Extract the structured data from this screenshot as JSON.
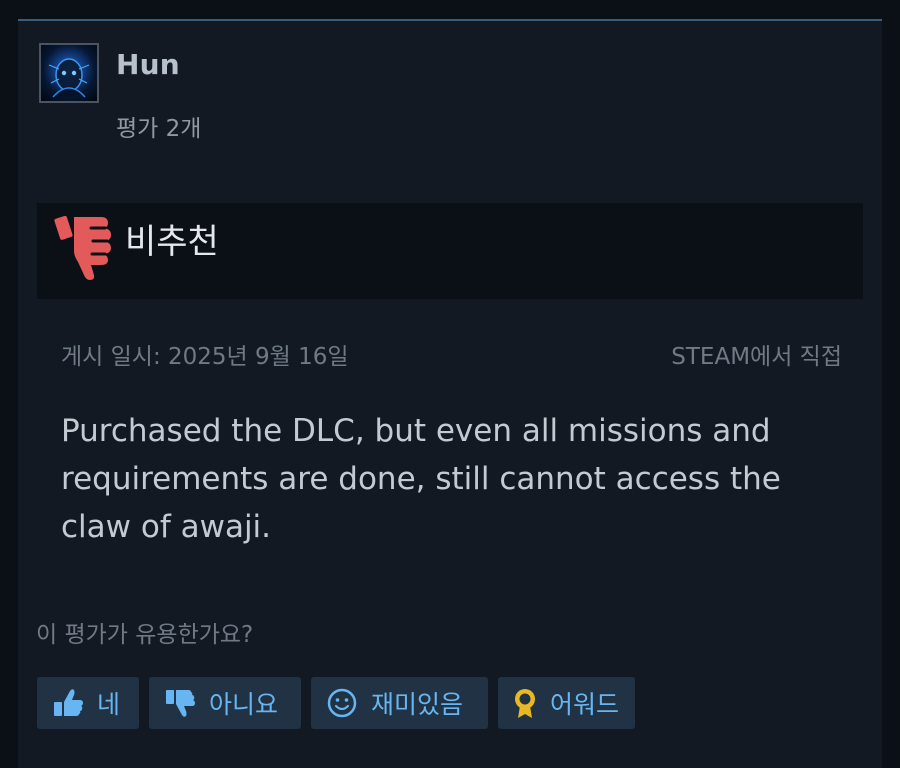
{
  "review": {
    "author": {
      "name": "Hun",
      "review_count": "평가 2개"
    },
    "verdict": {
      "label": "비추천",
      "icon": "thumbs-down-icon"
    },
    "posted": "게시 일시: 2025년 9월 16일",
    "source": "STEAM에서 직접",
    "body": "Purchased the DLC, but even all missions and requirements are done, still cannot access the claw of awaji."
  },
  "helpful": {
    "question": "이 평가가 유용한가요?",
    "buttons": [
      {
        "label": "네",
        "icon": "thumbs-up-icon"
      },
      {
        "label": "아니요",
        "icon": "thumbs-down-icon"
      },
      {
        "label": "재미있음",
        "icon": "smiley-icon"
      },
      {
        "label": "어워드",
        "icon": "award-icon"
      }
    ]
  },
  "colors": {
    "card_background": "#121923",
    "verdict_icon": "#e35a5a",
    "button_background": "#203244",
    "button_text": "#67b6f1"
  }
}
